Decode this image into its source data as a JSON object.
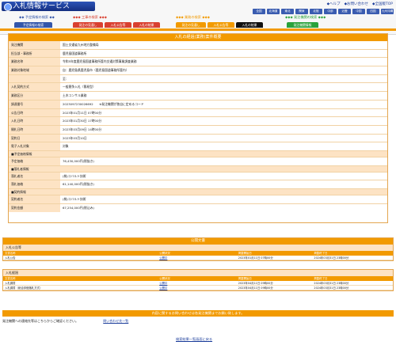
{
  "header": {
    "title": "入札情報サービス",
    "util_links": [
      "◆ヘルプ",
      "◆お問い合わせ",
      "◆全国版TOP"
    ],
    "regions": [
      "全国",
      "北海道",
      "東北",
      "関東",
      "北陸",
      "中部",
      "近畿",
      "中国",
      "四国",
      "九州沖縄"
    ],
    "categories": [
      "◆◆ 予定情報の検索 ◆◆",
      "◆◆◆ 工事の検索 ◆◆◆",
      "◆◆◆ 業務の検索 ◆◆◆",
      "◆◆◆ 発注機関の検索 ◆◆◆"
    ],
    "tabs": [
      "予定情報の検索",
      "発注の見通し",
      "入札公告等",
      "入札の結果",
      "発注の見通し",
      "入札公告等",
      "入札の結果",
      "発注機関情報"
    ]
  },
  "main": {
    "title": "入札の経過(業務)案件概要",
    "rows": [
      {
        "label": "発注機関",
        "value": "国土交通省九州地方整備局"
      },
      {
        "label": "担当部・事務所",
        "value": "鹿児島国道事務所"
      },
      {
        "label": "業務名称",
        "value": "令和5年度鹿児島国道事務所管内交通対策事業調査業務"
      },
      {
        "label": "業務対象地域",
        "value": "自：鹿児島県鹿児島市（鹿児島国道事務所管内）"
      },
      {
        "label": "",
        "value": "至："
      },
      {
        "label": "入札契約方式",
        "value": "一般競争入札（簡易型）"
      },
      {
        "label": "業務区分",
        "value": "土木コンサル業務"
      },
      {
        "label": "調達番号",
        "value": "2023097230026692　　※発注機関が独自に定めるコード"
      },
      {
        "label": "公告日時",
        "value": "2023年01月11日 07時00分"
      },
      {
        "label": "入札日時",
        "value": "2023年01月30日 17時00分"
      },
      {
        "label": "開札日時",
        "value": "2023年03月09日 14時00分"
      },
      {
        "label": "契約日",
        "value": "2023年03月10日"
      },
      {
        "label": "電子入札対象",
        "value": "対象"
      }
    ],
    "sections": [
      {
        "title": "■予定価格情報",
        "rows": [
          {
            "label": "予定価格",
            "value": "76,430,000円(税抜き)"
          }
        ]
      },
      {
        "title": "■落札者情報",
        "rows": [
          {
            "label": "落札者名",
            "value": "(株)コバルト技術"
          },
          {
            "label": "落札価格",
            "value": "61,140,000円(税抜き)"
          }
        ]
      },
      {
        "title": "■契約情報",
        "rows": [
          {
            "label": "契約者名",
            "value": "(株)コバルト技術"
          },
          {
            "label": "契約金額",
            "value": "67,254,000円(税込み)"
          }
        ]
      }
    ]
  },
  "docs": {
    "title": "公開文書",
    "headers": [
      "文書名称",
      "公開状況",
      "掲載開始日",
      "掲載終了日"
    ],
    "groups": [
      {
        "name": "入札公告等",
        "items": [
          [
            "入札公告",
            "公開中",
            "2023年01月11日 07時00分",
            "2024年03月31日 23時00分"
          ]
        ]
      },
      {
        "name": "入札経過",
        "items": [
          [
            "入札調書",
            "公開中",
            "2023年04月11日 09時00分",
            "2024年03月31日 23時00分"
          ],
          [
            "入札調書（総合評価落札方式）",
            "公開中",
            "2023年04月11日 09時00分",
            "2024年03月31日 23時00分"
          ]
        ]
      }
    ]
  },
  "footer": {
    "notice": "内容に関するお問い合わせは各発注機関までお願い致します。",
    "contact_label": "発注機関への連絡先等はこちらからご確認ください。",
    "contact_link": "問い合わせ先一覧",
    "back_link": "検索結果一覧画面に戻る"
  }
}
